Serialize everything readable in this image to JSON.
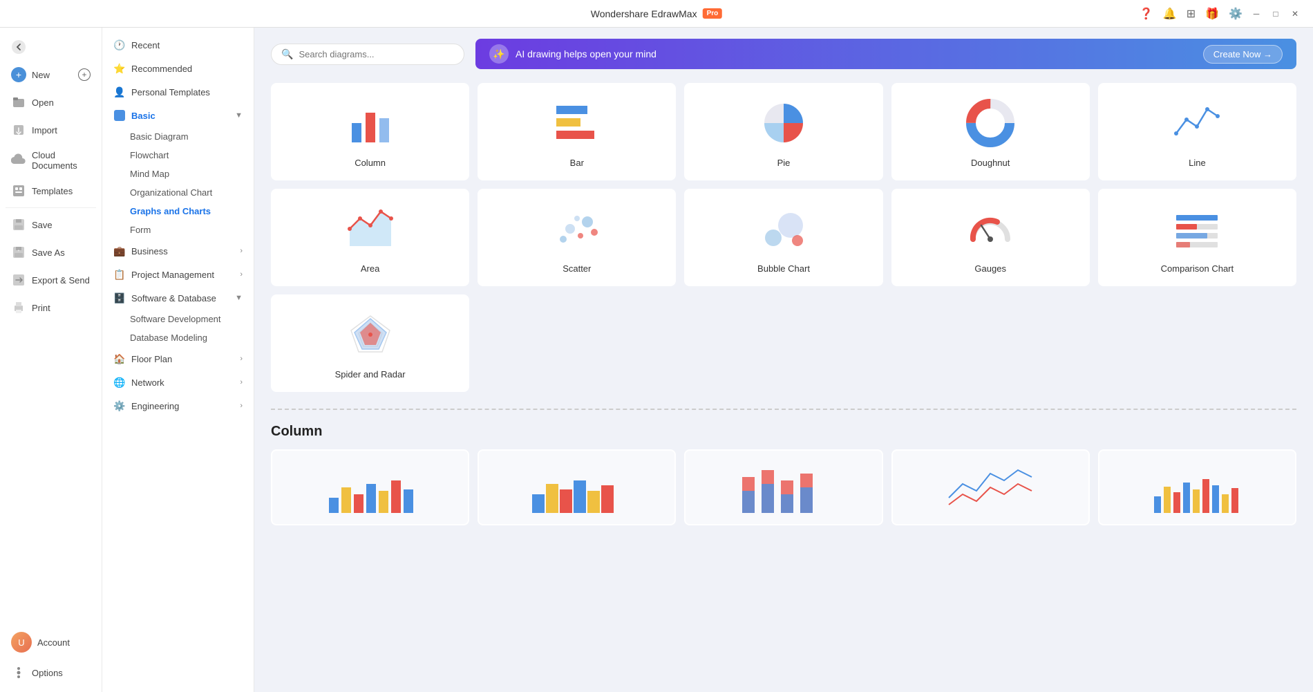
{
  "titlebar": {
    "app_name": "Wondershare EdrawMax",
    "pro_label": "Pro",
    "window_controls": [
      "minimize",
      "maximize",
      "close"
    ]
  },
  "header_icons": [
    "question-icon",
    "bell-icon",
    "grid-icon",
    "gift-icon",
    "settings-icon"
  ],
  "left_sidebar": {
    "items": [
      {
        "id": "back",
        "label": "Back",
        "icon": "back-arrow"
      },
      {
        "id": "new",
        "label": "New",
        "icon": "plus-circle"
      },
      {
        "id": "open",
        "label": "Open",
        "icon": "folder"
      },
      {
        "id": "import",
        "label": "Import",
        "icon": "import"
      },
      {
        "id": "cloud",
        "label": "Cloud Documents",
        "icon": "cloud"
      },
      {
        "id": "templates",
        "label": "Templates",
        "icon": "template"
      },
      {
        "id": "save",
        "label": "Save",
        "icon": "save"
      },
      {
        "id": "save-as",
        "label": "Save As",
        "icon": "save-as"
      },
      {
        "id": "export",
        "label": "Export & Send",
        "icon": "export"
      },
      {
        "id": "print",
        "label": "Print",
        "icon": "print"
      },
      {
        "id": "account",
        "label": "Account",
        "icon": "account"
      },
      {
        "id": "options",
        "label": "Options",
        "icon": "options"
      }
    ]
  },
  "nav_sidebar": {
    "sections": [
      {
        "id": "recent",
        "label": "Recent",
        "icon": "clock",
        "expandable": false
      },
      {
        "id": "recommended",
        "label": "Recommended",
        "icon": "star",
        "expandable": false
      },
      {
        "id": "personal",
        "label": "Personal Templates",
        "icon": "person",
        "expandable": false
      },
      {
        "id": "basic",
        "label": "Basic",
        "icon": "basic",
        "expandable": true,
        "expanded": true,
        "active": true,
        "children": [
          {
            "id": "basic-diagram",
            "label": "Basic Diagram"
          },
          {
            "id": "flowchart",
            "label": "Flowchart"
          },
          {
            "id": "mind-map",
            "label": "Mind Map"
          },
          {
            "id": "org-chart",
            "label": "Organizational Chart"
          },
          {
            "id": "graphs-charts",
            "label": "Graphs and Charts",
            "active": true
          },
          {
            "id": "form",
            "label": "Form"
          }
        ]
      },
      {
        "id": "business",
        "label": "Business",
        "icon": "business",
        "expandable": true
      },
      {
        "id": "project-mgmt",
        "label": "Project Management",
        "icon": "project",
        "expandable": true
      },
      {
        "id": "software-db",
        "label": "Software & Database",
        "icon": "software",
        "expandable": true,
        "expanded": true,
        "children": [
          {
            "id": "software-dev",
            "label": "Software Development"
          },
          {
            "id": "db-modeling",
            "label": "Database Modeling"
          }
        ]
      },
      {
        "id": "floor-plan",
        "label": "Floor Plan",
        "icon": "floorplan",
        "expandable": true
      },
      {
        "id": "network",
        "label": "Network",
        "icon": "network",
        "expandable": true
      },
      {
        "id": "engineering",
        "label": "Engineering",
        "icon": "engineering",
        "expandable": true
      }
    ]
  },
  "search": {
    "placeholder": "Search diagrams..."
  },
  "ai_banner": {
    "text": "AI drawing helps open your mind",
    "cta": "Create Now →"
  },
  "chart_types": [
    {
      "id": "column",
      "label": "Column"
    },
    {
      "id": "bar",
      "label": "Bar"
    },
    {
      "id": "pie",
      "label": "Pie"
    },
    {
      "id": "doughnut",
      "label": "Doughnut"
    },
    {
      "id": "line",
      "label": "Line"
    },
    {
      "id": "area",
      "label": "Area"
    },
    {
      "id": "scatter",
      "label": "Scatter"
    },
    {
      "id": "bubble",
      "label": "Bubble Chart"
    },
    {
      "id": "gauges",
      "label": "Gauges"
    },
    {
      "id": "comparison",
      "label": "Comparison Chart"
    },
    {
      "id": "spider",
      "label": "Spider and Radar"
    }
  ],
  "column_section": {
    "title": "Column",
    "templates_count": 5
  }
}
